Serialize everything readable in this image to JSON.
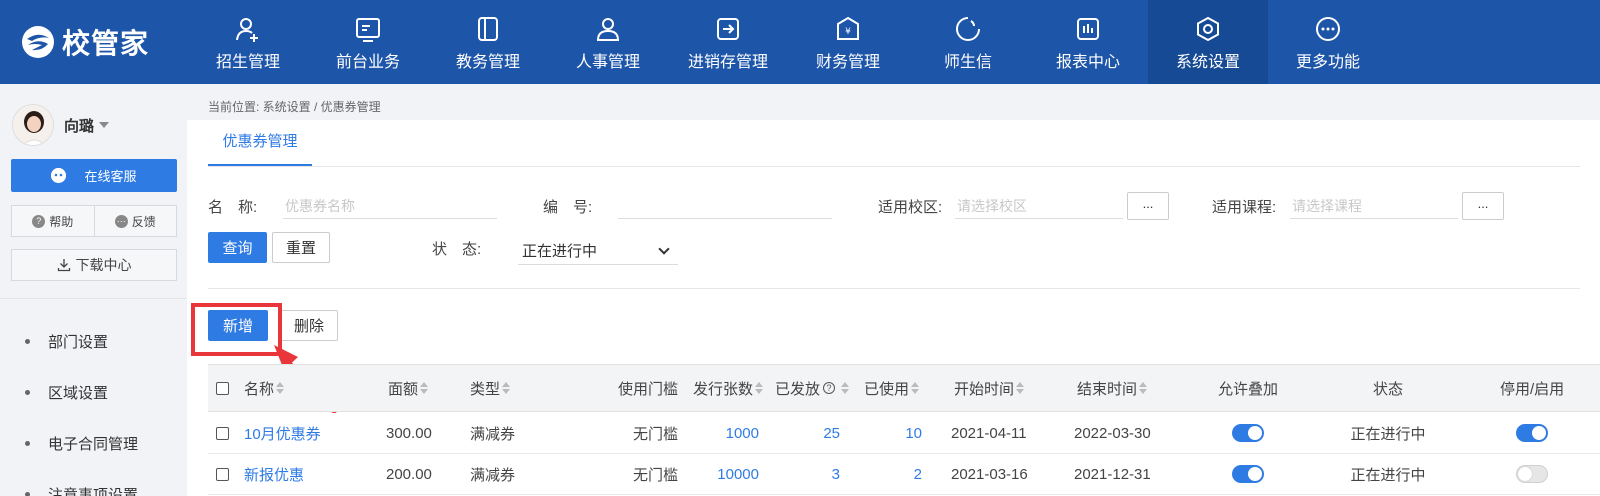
{
  "app": {
    "logo_text": "校管家"
  },
  "nav": {
    "items": [
      {
        "label": "招生管理",
        "icon": "user-plus-icon"
      },
      {
        "label": "前台业务",
        "icon": "reception-icon"
      },
      {
        "label": "教务管理",
        "icon": "book-icon"
      },
      {
        "label": "人事管理",
        "icon": "person-icon"
      },
      {
        "label": "进销存管理",
        "icon": "inventory-icon"
      },
      {
        "label": "财务管理",
        "icon": "finance-icon"
      },
      {
        "label": "师生信",
        "icon": "message-icon"
      },
      {
        "label": "报表中心",
        "icon": "report-icon"
      },
      {
        "label": "系统设置",
        "icon": "settings-icon"
      },
      {
        "label": "更多功能",
        "icon": "more-icon"
      }
    ],
    "active_index": 8
  },
  "sidebar": {
    "user_name": "向璐",
    "service_label": "在线客服",
    "help_label": "帮助",
    "feedback_label": "反馈",
    "download_label": "下载中心",
    "menu": [
      {
        "label": "部门设置"
      },
      {
        "label": "区域设置"
      },
      {
        "label": "电子合同管理"
      },
      {
        "label": "注意事项设置"
      }
    ]
  },
  "breadcrumb": "当前位置: 系统设置 / 优惠券管理",
  "tab": "优惠券管理",
  "filters": {
    "name_label": "名　称:",
    "name_placeholder": "优惠券名称",
    "code_label": "编　号:",
    "code_value": "",
    "campus_label": "适用校区:",
    "campus_placeholder": "请选择校区",
    "course_label": "适用课程:",
    "course_placeholder": "请选择课程",
    "dots": "...",
    "status_label": "状　态:",
    "status_value": "正在进行中",
    "query_label": "查询",
    "reset_label": "重置"
  },
  "actions": {
    "add_label": "新增",
    "delete_label": "删除"
  },
  "colors": {
    "brand": "#1d55a8",
    "accent": "#2f7be4",
    "highlight": "#e8363b"
  },
  "table": {
    "headers": {
      "name": "名称",
      "amount": "面额",
      "type": "类型",
      "threshold": "使用门槛",
      "issue_count": "发行张数",
      "issued": "已发放",
      "used": "已使用",
      "start": "开始时间",
      "end": "结束时间",
      "stack": "允许叠加",
      "status": "状态",
      "enable": "停用/启用"
    },
    "rows": [
      {
        "name": "10月优惠券",
        "amount": "300.00",
        "type": "满减券",
        "threshold": "无门槛",
        "issue_count": "1000",
        "issued": "25",
        "used": "10",
        "start": "2021-04-11",
        "end": "2022-03-30",
        "stack": true,
        "status": "正在进行中",
        "enabled": true
      },
      {
        "name": "新报优惠",
        "amount": "200.00",
        "type": "满减券",
        "threshold": "无门槛",
        "issue_count": "10000",
        "issued": "3",
        "used": "2",
        "start": "2021-03-16",
        "end": "2021-12-31",
        "stack": true,
        "status": "正在进行中",
        "enabled": false
      }
    ]
  }
}
